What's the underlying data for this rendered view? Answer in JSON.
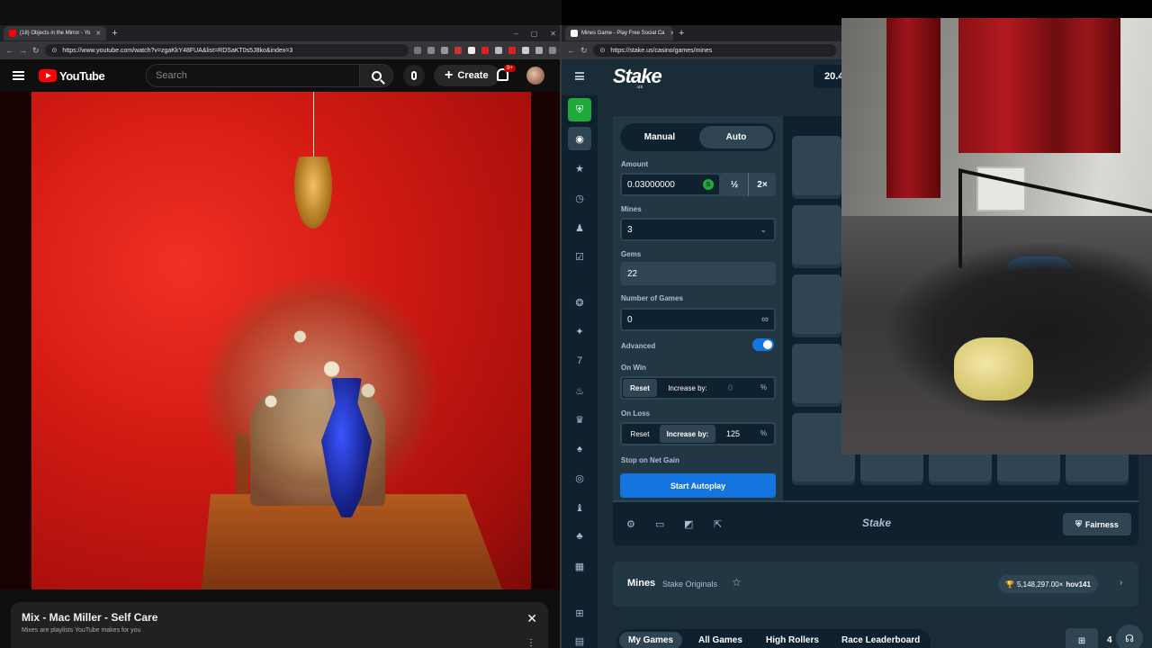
{
  "left_browser": {
    "tab_title": "(18) Objects in the Mirror - Yo",
    "url": "https://www.youtube.com/watch?v=zgaKkY48FUA&list=RDSaKT0s5J8ko&index=3"
  },
  "right_browser": {
    "tab_title": "Mines Game - Play Free Social Ca",
    "url": "https://stake.us/casino/games/mines"
  },
  "youtube": {
    "logo_text": "YouTube",
    "search_placeholder": "Search",
    "create_label": "Create",
    "notif_badge": "9+"
  },
  "mix": {
    "title": "Mix - Mac Miller - Self Care",
    "subtitle": "Mixes are playlists YouTube makes for you",
    "close": "✕",
    "more": "⋮"
  },
  "stake": {
    "logo": "Stake",
    "logo_sub": ".us",
    "balance": "20.4",
    "mode_manual": "Manual",
    "mode_auto": "Auto",
    "amount_label": "Amount",
    "amount_value": "0.03000000",
    "coin": "S",
    "half": "½",
    "double": "2×",
    "mines_label": "Mines",
    "mines_value": "3",
    "gems_label": "Gems",
    "gems_value": "22",
    "num_games_label": "Number of Games",
    "num_games_value": "0",
    "infinity": "∞",
    "advanced_label": "Advanced",
    "advanced_on": true,
    "on_win_label": "On Win",
    "on_win_reset": "Reset",
    "on_win_increase": "Increase by:",
    "on_win_value": "0",
    "on_loss_label": "On Loss",
    "on_loss_reset": "Reset",
    "on_loss_increase": "Increase by:",
    "on_loss_value": "125",
    "pct": "%",
    "stop_net_gain": "Stop on Net Gain",
    "start_autoplay": "Start Autoplay",
    "bottom_logo": "Stake",
    "fairness": "Fairness",
    "game_title": "Mines",
    "game_sub": "Stake Originals",
    "top_win": "5,148,297.00×",
    "top_win_user": "hov141",
    "tabs": [
      "My Games",
      "All Games",
      "High Rollers",
      "Race Leaderboard"
    ],
    "tab_clip": "4"
  }
}
